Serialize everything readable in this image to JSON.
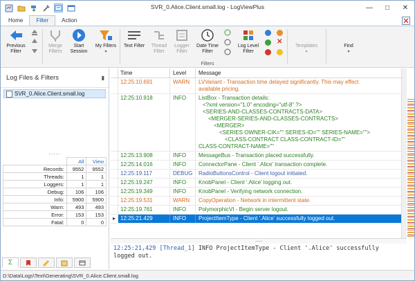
{
  "window": {
    "title": "SVR_0.Alice.Client.small.log - LogViewPlus"
  },
  "tabs": [
    {
      "label": "Home"
    },
    {
      "label": "Filter"
    },
    {
      "label": "Action"
    }
  ],
  "ribbon": {
    "group_label": "Filters",
    "buttons": {
      "previous_filter": "Previous Filter",
      "merge_filters": "Merge Filters",
      "start_session": "Start Session",
      "my_filters": "My Filters",
      "text_filter": "Text Filter",
      "thread_filter": "Thread Filter",
      "logger_filter": "Logger Filter",
      "date_time_filter": "Date Time Filter",
      "log_level_filter": "Log Level Filter",
      "templates": "Templates",
      "find": "Find"
    },
    "colors": {
      "blue": "#2f7ed8",
      "orange": "#e8902a",
      "green": "#3aa33a",
      "red": "#d2372c",
      "yellow": "#f2c11c"
    }
  },
  "left_panel": {
    "title": "Log Files & Filters",
    "file": "SVR_0.Alice.Client.small.log",
    "splitter": ".....",
    "stats_headers": {
      "all": "All",
      "view": "View"
    },
    "stats": [
      {
        "label": "Records:",
        "all": "9552",
        "view": "9552"
      },
      {
        "label": "Threads:",
        "all": "1",
        "view": "1"
      },
      {
        "label": "Loggers:",
        "all": "1",
        "view": "1"
      },
      {
        "label": "Debug:",
        "all": "106",
        "view": "106"
      },
      {
        "label": "Info:",
        "all": "5900",
        "view": "5900"
      },
      {
        "label": "Warn:",
        "all": "493",
        "view": "493"
      },
      {
        "label": "Error:",
        "all": "153",
        "view": "153"
      },
      {
        "label": "Fatal:",
        "all": "0",
        "view": "0"
      }
    ]
  },
  "grid": {
    "columns": {
      "time": "Time",
      "level": "Level",
      "message": "Message"
    },
    "rows": [
      {
        "time": "12:25:10.691",
        "level": "WARN",
        "message": [
          "LVVariant - Transaction time delayed significantly.  This may effect",
          "available pricing."
        ]
      },
      {
        "time": "12:25:10.918",
        "level": "INFO",
        "message": [
          "ListBox - Transaction details:",
          "<?xml version=\"1.0\" encoding=\"utf-8\" ?>",
          "<SERIES-AND-CLASSES-CONTRACTS-DATA>",
          "<MERGER-SERIES-AND-CLASSES-CONTRACTS>",
          "<MERGER>",
          "<SERIES OWNER-CIK=\"\" SERIES-ID=\"\" SERIES-NAME=\"\">",
          "<CLASS-CONTRACT CLASS-CONTRACT-ID=\"\"",
          "CLASS-CONTRACT-NAME=\"\""
        ]
      },
      {
        "time": "12:25:13.908",
        "level": "INFO",
        "message": [
          "MessageBus - Transaction placed successfully."
        ]
      },
      {
        "time": "12:25:14.016",
        "level": "INFO",
        "message": [
          "ConnectorPane - Client '.Alice' transaction complete."
        ]
      },
      {
        "time": "12:25:19.117",
        "level": "DEBUG",
        "message": [
          "RadioButtonsControl - Client logout initiated."
        ]
      },
      {
        "time": "12:25:19.247",
        "level": "INFO",
        "message": [
          "KnobPanel - Client '.Alice' logging out."
        ]
      },
      {
        "time": "12:25:19.349",
        "level": "INFO",
        "message": [
          "KnobPanel - Verifying network connection."
        ]
      },
      {
        "time": "12:25:19.531",
        "level": "WARN",
        "message": [
          "CopyOperation - Network in intermittent state."
        ]
      },
      {
        "time": "12:25:19.761",
        "level": "INFO",
        "message": [
          "PolymorphicVI - Begin server logout."
        ]
      },
      {
        "time": "12:25:21.429",
        "level": "INFO",
        "message": [
          "ProjectItemType - Client '.Alice' successfully logged out."
        ],
        "selected": true
      }
    ]
  },
  "hsplit": ".....",
  "detail": {
    "time": "12:25:21,429",
    "thread": "[Thread_1]",
    "line1_rest": " INFO  ProjectItemType - Client '.Alice' successfully",
    "line2": "logged out."
  },
  "statusbar": {
    "path": "D:\\Data\\Logs\\Text\\Generating\\SVR_0.Alice.Client.small.log"
  }
}
